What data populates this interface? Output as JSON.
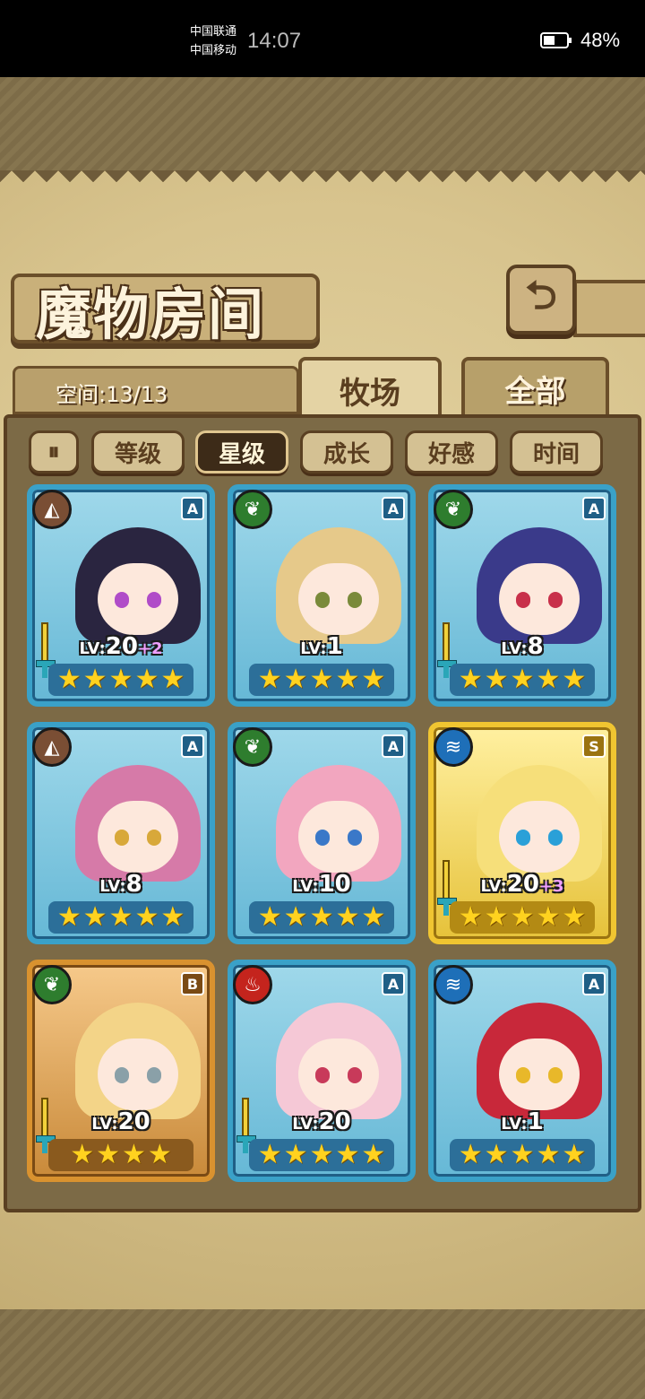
{
  "status_bar": {
    "carrier_1": "中国联通",
    "carrier_2": "中国移动",
    "time": "14:07",
    "battery": "48%",
    "battery_level": 0.48
  },
  "header": {
    "title": "魔物房间",
    "back_icon": "back-arrow-icon"
  },
  "tabs": {
    "space": "空间:13/13",
    "ranch": "牧场",
    "all": "全部",
    "active": "ranch"
  },
  "sort": {
    "toggle_icon": "sort-toggle-icon",
    "options": [
      "等级",
      "星级",
      "成长",
      "好感",
      "时间"
    ],
    "active": "星级"
  },
  "colors": {
    "earth": "#7a4e34",
    "wood": "#2e7d2e",
    "water": "#1e6fb8",
    "fire": "#c4241d",
    "rank_A": "#3aa1c8",
    "rank_S": "#f0c531",
    "rank_B": "#d9922f"
  },
  "monsters": [
    {
      "element": "earth",
      "rank": "A",
      "level_label": "LV:",
      "level": "20",
      "bonus": "+2",
      "stars": 5,
      "weapon": true,
      "hair": "#2a2540",
      "eye": "#b04cc8"
    },
    {
      "element": "wood",
      "rank": "A",
      "level_label": "LV:",
      "level": "1",
      "bonus": "",
      "stars": 5,
      "weapon": false,
      "hair": "#e6c98a",
      "eye": "#7a8a3a"
    },
    {
      "element": "wood",
      "rank": "A",
      "level_label": "LV:",
      "level": "8",
      "bonus": "",
      "stars": 5,
      "weapon": true,
      "hair": "#3a3a8a",
      "eye": "#c8304a"
    },
    {
      "element": "earth",
      "rank": "A",
      "level_label": "LV:",
      "level": "8",
      "bonus": "",
      "stars": 5,
      "weapon": false,
      "hair": "#d67aa8",
      "eye": "#d8a83a"
    },
    {
      "element": "wood",
      "rank": "A",
      "level_label": "LV:",
      "level": "10",
      "bonus": "",
      "stars": 5,
      "weapon": false,
      "hair": "#f2a6bf",
      "eye": "#3a78c8"
    },
    {
      "element": "water",
      "rank": "S",
      "level_label": "LV:",
      "level": "20",
      "bonus": "+3",
      "stars": 5,
      "weapon": true,
      "hair": "#f6df7a",
      "eye": "#2aa0d8"
    },
    {
      "element": "wood",
      "rank": "B",
      "level_label": "LV:",
      "level": "20",
      "bonus": "",
      "stars": 4,
      "weapon": true,
      "hair": "#f3d488",
      "eye": "#8aa0a8"
    },
    {
      "element": "fire",
      "rank": "A",
      "level_label": "LV:",
      "level": "20",
      "bonus": "",
      "stars": 5,
      "weapon": true,
      "hair": "#f5c8d6",
      "eye": "#c83a5a"
    },
    {
      "element": "water",
      "rank": "A",
      "level_label": "LV:",
      "level": "1",
      "bonus": "",
      "stars": 5,
      "weapon": false,
      "hair": "#c8283a",
      "eye": "#e8b82a"
    }
  ]
}
